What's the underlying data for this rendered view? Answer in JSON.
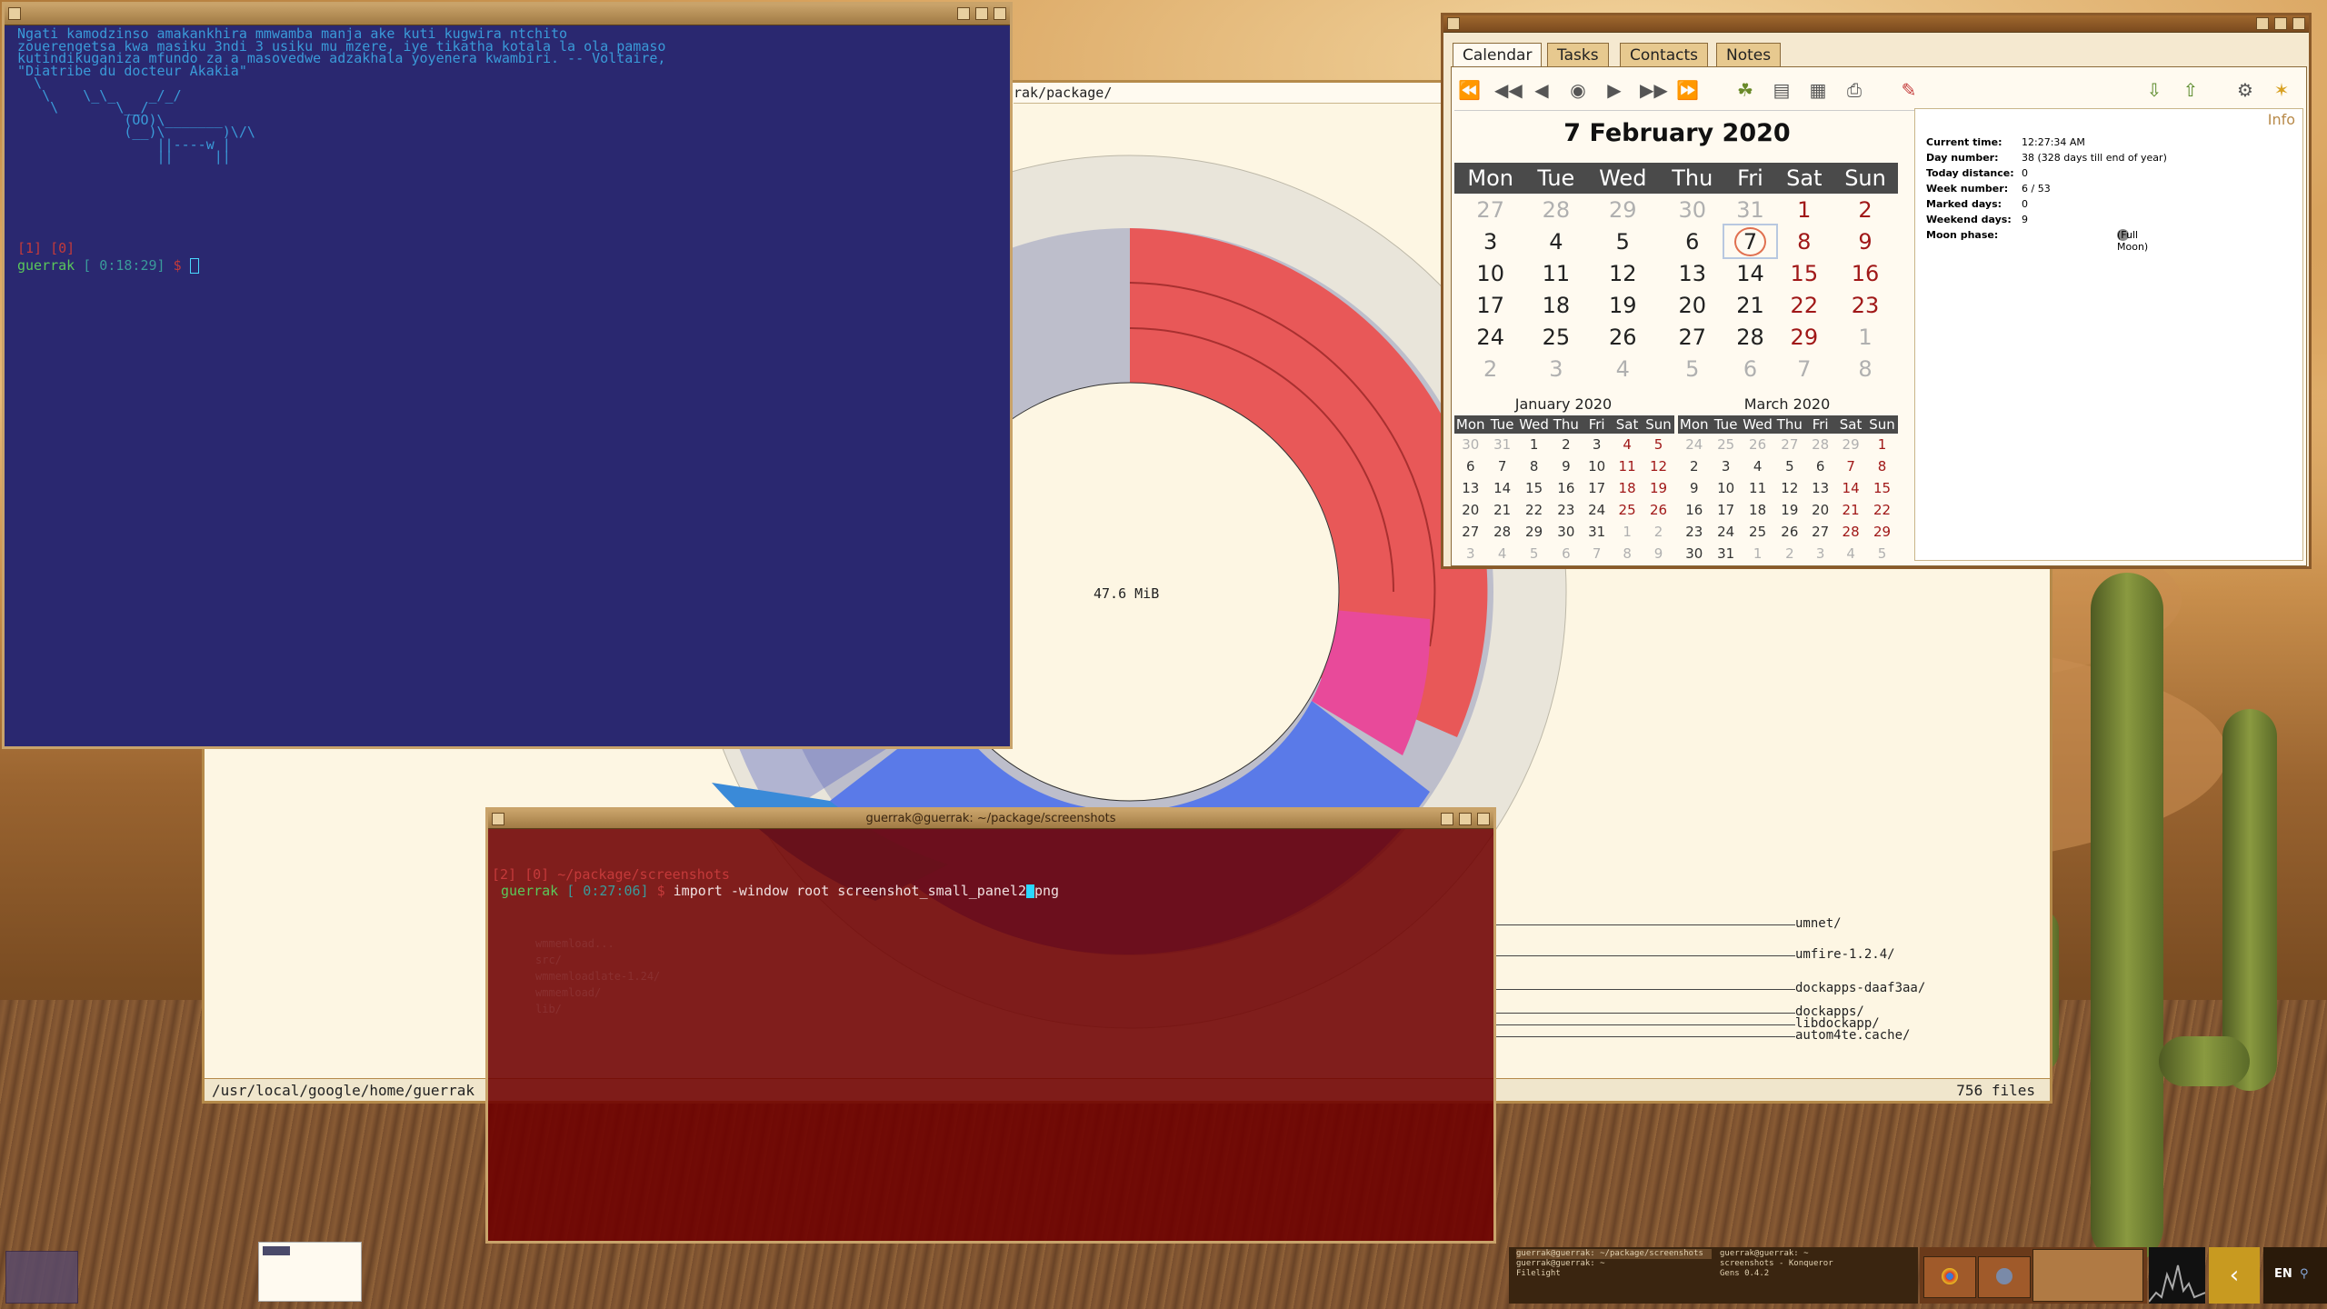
{
  "terminal_top": {
    "lines": [
      "Ngati kamodzinso amakankhira mmwamba manja ake kuti kugwira ntchito",
      "zouerengetsa kwa masiku 3ndi 3 usiku mu mzere, iye tikatha kotala la ola pamaso",
      "kutindikuganiza mfundo za a masovedwe adzakhala yoyenera kwambiri. -- Voltaire,",
      "\"Diatribe du docteur Akakia\"",
      "  \\",
      "   \\    \\_\\_    _/_/",
      "    \\       \\__/",
      "             (OO)\\_______",
      "             (__)\\       )\\/\\",
      "                 ||----w |",
      "                 ||     ||"
    ],
    "prompt_user": "guerrak",
    "prompt_time": "[ 0:18:29]",
    "prompt_prev": "[1] [0]"
  },
  "filelight": {
    "path_bar": "rak/package/",
    "center_size": "47.6 MiB",
    "status_path": "/usr/local/google/home/guerrak",
    "status_files": "756 files",
    "labels": [
      "umnet/",
      "umfire-1.2.4/",
      "dockapps-daaf3aa/",
      "dockapps/",
      "libdockapp/",
      "autom4te.cache/"
    ]
  },
  "terminal_bottom": {
    "title": "guerrak@guerrak: ~/package/screenshots",
    "prev_line": "[2] [0] ~/package/screenshots",
    "prompt_user": "guerrak",
    "prompt_time": "[ 0:27:06]",
    "command_before": "import -window root screenshot_small_panel2",
    "command_after": "png",
    "faded_labels": [
      "wmmemload...",
      "src/",
      "wmmemloadlate-1.24/",
      "wmmemload/",
      "lib/"
    ]
  },
  "calendar": {
    "tabs": [
      "Calendar",
      "Tasks",
      "Contacts",
      "Notes"
    ],
    "date_title": "7 February 2020",
    "weekdays": [
      "Mon",
      "Tue",
      "Wed",
      "Thu",
      "Fri",
      "Sat",
      "Sun"
    ],
    "weeks": [
      [
        "27",
        "28",
        "29",
        "30",
        "31",
        "1",
        "2"
      ],
      [
        "3",
        "4",
        "5",
        "6",
        "7",
        "8",
        "9"
      ],
      [
        "10",
        "11",
        "12",
        "13",
        "14",
        "15",
        "16"
      ],
      [
        "17",
        "18",
        "19",
        "20",
        "21",
        "22",
        "23"
      ],
      [
        "24",
        "25",
        "26",
        "27",
        "28",
        "29",
        "1"
      ],
      [
        "2",
        "3",
        "4",
        "5",
        "6",
        "7",
        "8"
      ]
    ],
    "selected_day": "7",
    "prev_month": {
      "title": "January 2020",
      "weeks": [
        [
          "30",
          "31",
          "1",
          "2",
          "3",
          "4",
          "5"
        ],
        [
          "6",
          "7",
          "8",
          "9",
          "10",
          "11",
          "12"
        ],
        [
          "13",
          "14",
          "15",
          "16",
          "17",
          "18",
          "19"
        ],
        [
          "20",
          "21",
          "22",
          "23",
          "24",
          "25",
          "26"
        ],
        [
          "27",
          "28",
          "29",
          "30",
          "31",
          "1",
          "2"
        ],
        [
          "3",
          "4",
          "5",
          "6",
          "7",
          "8",
          "9"
        ]
      ]
    },
    "next_month": {
      "title": "March 2020",
      "weeks": [
        [
          "24",
          "25",
          "26",
          "27",
          "28",
          "29",
          "1"
        ],
        [
          "2",
          "3",
          "4",
          "5",
          "6",
          "7",
          "8"
        ],
        [
          "9",
          "10",
          "11",
          "12",
          "13",
          "14",
          "15"
        ],
        [
          "16",
          "17",
          "18",
          "19",
          "20",
          "21",
          "22"
        ],
        [
          "23",
          "24",
          "25",
          "26",
          "27",
          "28",
          "29"
        ],
        [
          "30",
          "31",
          "1",
          "2",
          "3",
          "4",
          "5"
        ]
      ]
    },
    "info": {
      "heading": "Info",
      "current_time_label": "Current time:",
      "current_time": "12:27:34 AM",
      "day_number_label": "Day number:",
      "day_number": "38 (328 days till end of year)",
      "today_distance_label": "Today distance:",
      "today_distance": "0",
      "week_number_label": "Week number:",
      "week_number": "6 / 53",
      "marked_days_label": "Marked days:",
      "marked_days": "0",
      "weekend_days_label": "Weekend days:",
      "weekend_days": "9",
      "moon_phase_label": "Moon phase:",
      "moon_phase": "(Full Moon)"
    }
  },
  "taskbar": {
    "tasks_left": [
      "guerrak@guerrak: ~/package/screenshots",
      "guerrak@guerrak: ~",
      "Filelight"
    ],
    "tasks_right": [
      "guerrak@guerrak: ~",
      "screenshots - Konqueror",
      "Gens 0.4.2"
    ],
    "lang": "EN"
  }
}
